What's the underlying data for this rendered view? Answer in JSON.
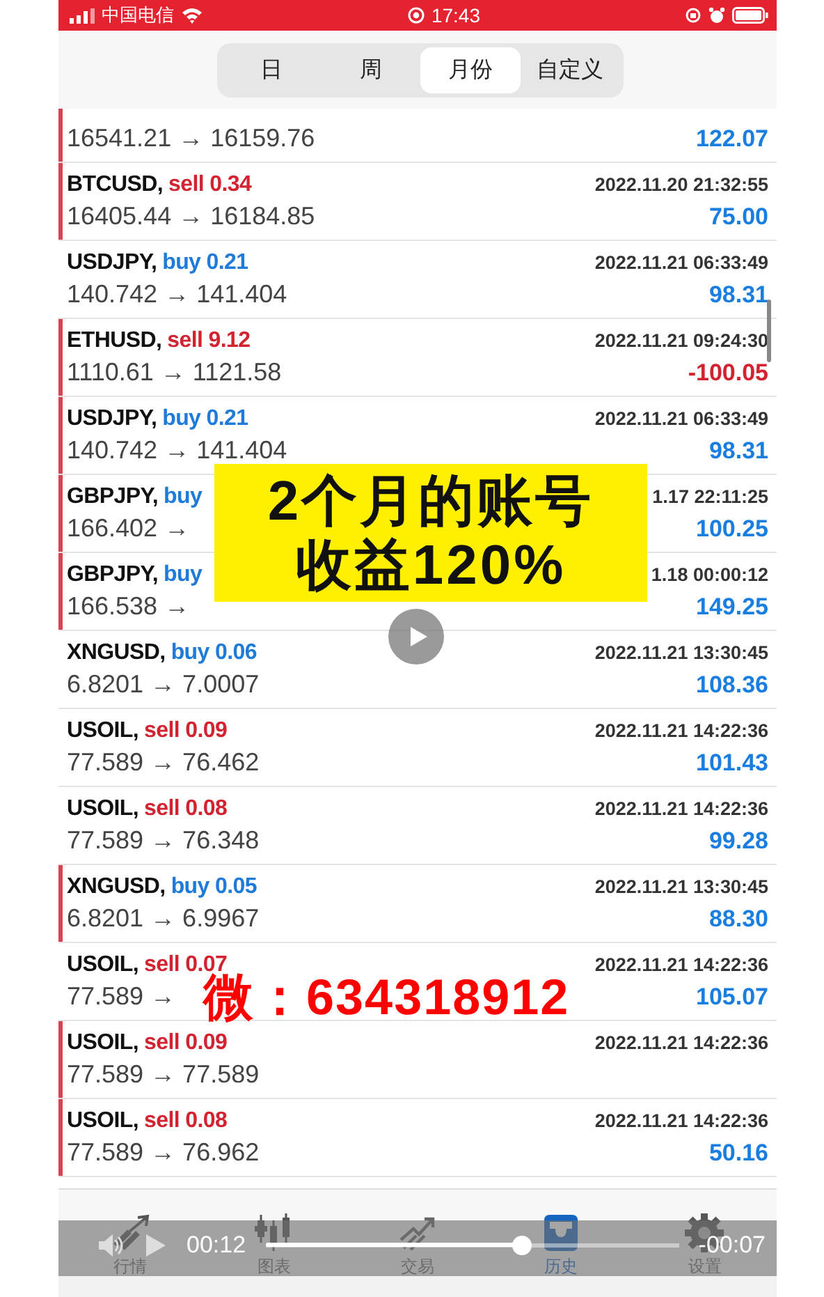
{
  "status_bar": {
    "carrier": "中国电信",
    "time": "17:43"
  },
  "period_tabs": [
    {
      "label": "日",
      "selected": false
    },
    {
      "label": "周",
      "selected": false
    },
    {
      "label": "月份",
      "selected": true
    },
    {
      "label": "自定义",
      "selected": false
    }
  ],
  "trades": [
    {
      "flagged": true,
      "price": "16541.21 → 16159.76",
      "profit": "122.07",
      "loss": false
    },
    {
      "flagged": true,
      "symbol": "BTCUSD,",
      "side": "sell",
      "kind": "sell",
      "volume": "0.34",
      "time": "2022.11.20 21:32:55",
      "price": "16405.44 → 16184.85",
      "profit": "75.00",
      "loss": false
    },
    {
      "flagged": false,
      "symbol": "USDJPY,",
      "side": "buy",
      "kind": "buy",
      "volume": "0.21",
      "time": "2022.11.21 06:33:49",
      "price": "140.742 → 141.404",
      "profit": "98.31",
      "loss": false
    },
    {
      "flagged": true,
      "symbol": "ETHUSD,",
      "side": "sell",
      "kind": "sell",
      "volume": "9.12",
      "time": "2022.11.21 09:24:30",
      "price": "1110.61 → 1121.58",
      "profit": "-100.05",
      "loss": true
    },
    {
      "flagged": true,
      "symbol": "USDJPY,",
      "side": "buy",
      "kind": "buy",
      "volume": "0.21",
      "time": "2022.11.21 06:33:49",
      "price": "140.742 → 141.404",
      "profit": "98.31",
      "loss": false
    },
    {
      "flagged": true,
      "symbol": "GBPJPY,",
      "side": "buy",
      "kind": "buy",
      "time": "1.17 22:11:25",
      "price": "166.402 →",
      "profit": "100.25",
      "loss": false
    },
    {
      "flagged": true,
      "symbol": "GBPJPY,",
      "side": "buy",
      "kind": "buy",
      "time": "1.18 00:00:12",
      "price": "166.538 →",
      "profit": "149.25",
      "loss": false
    },
    {
      "flagged": false,
      "symbol": "XNGUSD,",
      "side": "buy",
      "kind": "buy",
      "volume": "0.06",
      "time": "2022.11.21 13:30:45",
      "price": "6.8201 → 7.0007",
      "profit": "108.36",
      "loss": false
    },
    {
      "flagged": false,
      "symbol": "USOIL,",
      "side": "sell",
      "kind": "sell",
      "volume": "0.09",
      "time": "2022.11.21 14:22:36",
      "price": "77.589 → 76.462",
      "profit": "101.43",
      "loss": false
    },
    {
      "flagged": false,
      "symbol": "USOIL,",
      "side": "sell",
      "kind": "sell",
      "volume": "0.08",
      "time": "2022.11.21 14:22:36",
      "price": "77.589 → 76.348",
      "profit": "99.28",
      "loss": false
    },
    {
      "flagged": true,
      "symbol": "XNGUSD,",
      "side": "buy",
      "kind": "buy",
      "volume": "0.05",
      "time": "2022.11.21 13:30:45",
      "price": "6.8201 → 6.9967",
      "profit": "88.30",
      "loss": false
    },
    {
      "flagged": false,
      "symbol": "USOIL,",
      "side": "sell",
      "kind": "sell",
      "volume": "0.07",
      "time": "2022.11.21 14:22:36",
      "price": "77.589 →",
      "profit": "105.07",
      "loss": false
    },
    {
      "flagged": true,
      "symbol": "USOIL,",
      "side": "sell",
      "kind": "sell",
      "volume": "0.09",
      "time": "2022.11.21 14:22:36",
      "price": "77.589 → 77.589"
    },
    {
      "flagged": true,
      "symbol": "USOIL,",
      "side": "sell",
      "kind": "sell",
      "volume": "0.08",
      "time": "2022.11.21 14:22:36",
      "price": "77.589 → 76.962",
      "profit": "50.16",
      "loss": false
    }
  ],
  "overlay_banner": {
    "lines": [
      "2个月的账号",
      "收益120%"
    ]
  },
  "overlay_contact": "微：634318912",
  "bottom_tabs": [
    {
      "label": "行情",
      "kind": "quotes",
      "selected": false
    },
    {
      "label": "图表",
      "kind": "chart",
      "selected": false
    },
    {
      "label": "交易",
      "kind": "trade",
      "selected": false
    },
    {
      "label": "历史",
      "kind": "history",
      "selected": true
    },
    {
      "label": "设置",
      "kind": "settings",
      "selected": false
    }
  ],
  "video_controls": {
    "elapsed": "00:12",
    "remaining": "-00:07",
    "level": 0.62
  }
}
